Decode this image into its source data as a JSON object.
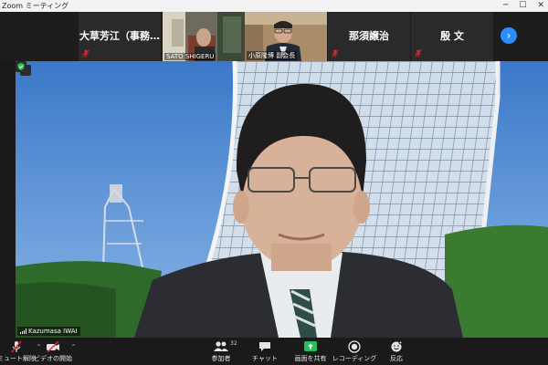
{
  "window": {
    "title": "Zoom ミーティング"
  },
  "gallery": {
    "tiles": [
      {
        "name": "大草芳江（事務…",
        "muted": true
      },
      {
        "label": "SATO SHIGERU"
      },
      {
        "label": "小原隆博 副会長"
      },
      {
        "name": "那須譲治",
        "muted": true
      },
      {
        "name": "殷 文",
        "muted": true
      }
    ]
  },
  "main_video": {
    "speaker": "Kazumasa IWAI"
  },
  "toolbar": {
    "unmute_label": "ミュート解除",
    "start_video_label": "ビデオの開始",
    "participants_label": "参加者",
    "participants_count": "32",
    "chat_label": "チャット",
    "share_label": "画面を共有",
    "record_label": "レコーディング",
    "reactions_label": "反応",
    "caret": "^"
  },
  "colors": {
    "accent_blue": "#2d8cff",
    "share_green": "#23c15f",
    "muted_red": "#e02828"
  }
}
